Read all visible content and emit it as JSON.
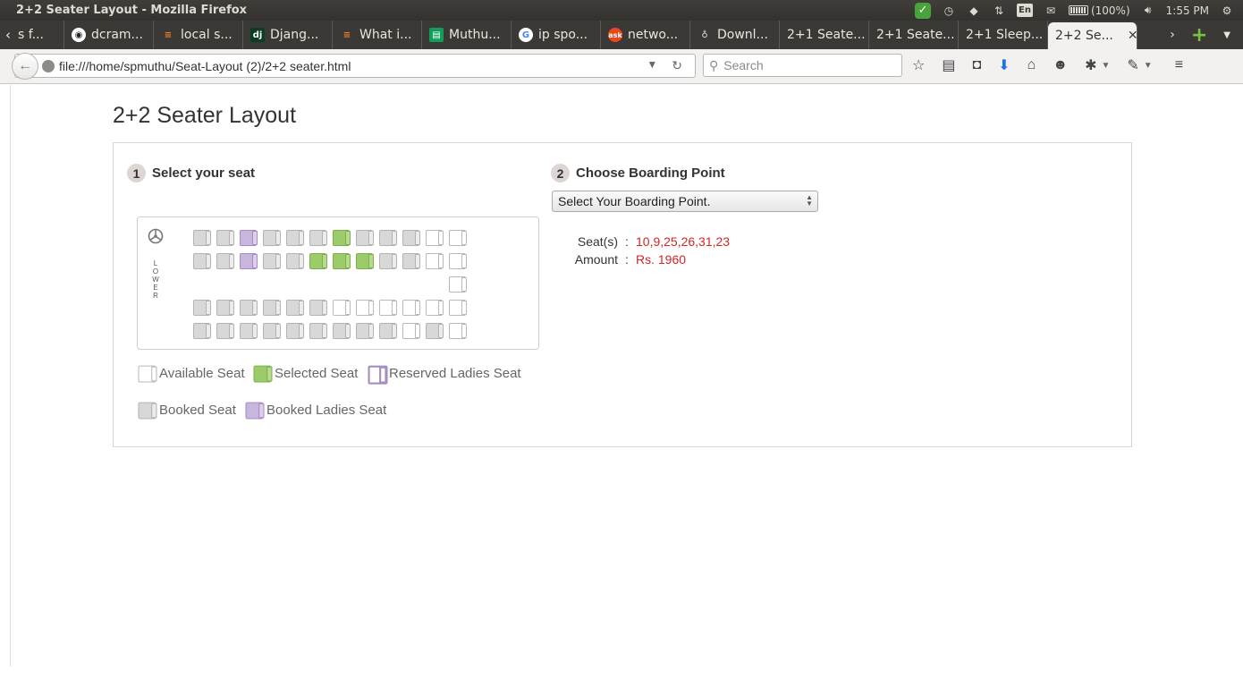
{
  "window": {
    "title": "2+2 Seater Layout - Mozilla Firefox"
  },
  "tray": {
    "lang": "En",
    "battery": "(100%)",
    "time": "1:55 PM"
  },
  "tabs": [
    {
      "label": "s f...",
      "icon": "stackoverflow-icon"
    },
    {
      "label": "dcram...",
      "icon": "github-icon"
    },
    {
      "label": "local s...",
      "icon": "stackoverflow-icon"
    },
    {
      "label": "Djang...",
      "icon": "django-icon"
    },
    {
      "label": "What i...",
      "icon": "stackoverflow-icon"
    },
    {
      "label": "Muthu...",
      "icon": "sheets-icon"
    },
    {
      "label": "ip spo...",
      "icon": "google-icon"
    },
    {
      "label": "netwo...",
      "icon": "askubuntu-icon"
    },
    {
      "label": "Downl...",
      "icon": "download-icon"
    },
    {
      "label": "2+1 Seate...",
      "icon": ""
    },
    {
      "label": "2+1 Seate...",
      "icon": ""
    },
    {
      "label": "2+1 Sleep...",
      "icon": ""
    },
    {
      "label": "2+2 Se...",
      "icon": "",
      "active": true
    }
  ],
  "navbar": {
    "url": "file:///home/spmuthu/Seat-Layout (2)/2+2 seater.html",
    "search_placeholder": "Search"
  },
  "page": {
    "title": "2+2 Seater Layout",
    "step1": {
      "num": "1",
      "label": "Select your seat"
    },
    "step2": {
      "num": "2",
      "label": "Choose Boarding Point"
    },
    "boarding_select": "Select Your Boarding Point.",
    "summary": {
      "seats_label": "Seat(s)",
      "seats_value": "10,9,25,26,31,23",
      "amount_label": "Amount",
      "amount_value": "Rs. 1960",
      "colon": ":"
    },
    "deck_label": [
      "L",
      "O",
      "W",
      "E",
      "R"
    ],
    "seat_rows": [
      [
        "booked",
        "booked",
        "ladies-booked",
        "booked",
        "booked",
        "booked",
        "selected",
        "booked",
        "booked",
        "booked",
        "available",
        "available"
      ],
      [
        "booked",
        "booked",
        "ladies-booked",
        "booked",
        "booked",
        "selected",
        "selected",
        "selected",
        "booked",
        "booked",
        "available",
        "available"
      ],
      [
        "",
        "",
        "",
        "",
        "",
        "",
        "",
        "",
        "",
        "",
        "",
        "available"
      ],
      [
        "booked",
        "booked",
        "booked",
        "booked",
        "booked",
        "booked",
        "available",
        "available",
        "available",
        "available",
        "available",
        "available"
      ],
      [
        "booked",
        "booked",
        "booked",
        "booked",
        "booked",
        "booked",
        "booked",
        "booked",
        "booked",
        "available",
        "booked",
        "available"
      ]
    ],
    "legend": {
      "available": "Available Seat",
      "selected": "Selected Seat",
      "reserved_ladies": "Reserved Ladies Seat",
      "booked": "Booked Seat",
      "booked_ladies": "Booked Ladies Seat"
    }
  },
  "colors": {
    "selected": "#9ccc6a",
    "ladies": "#c9b6de",
    "booked": "#d8d8d8",
    "value_red": "#d42525"
  }
}
